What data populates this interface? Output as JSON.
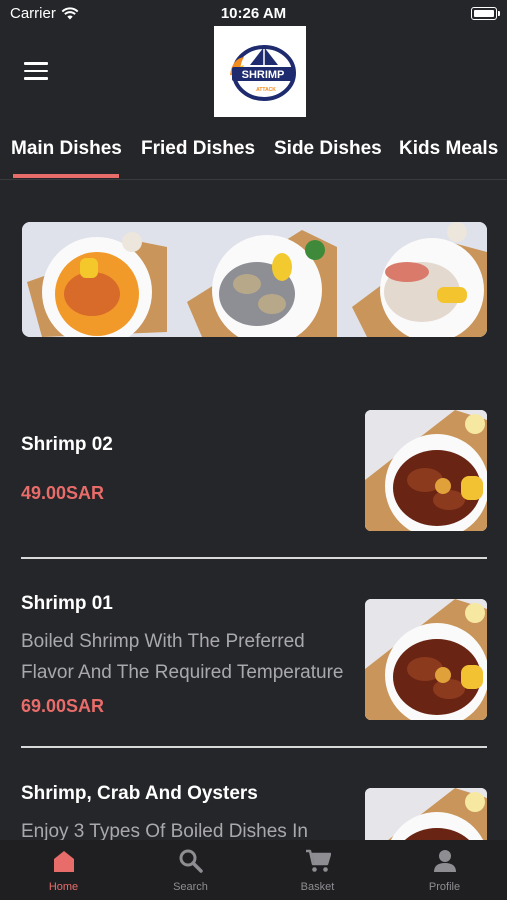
{
  "status_bar": {
    "carrier": "Carrier",
    "time": "10:26 AM"
  },
  "header": {
    "logo_text": "SHRIMP",
    "logo_subtext": "ATTACK"
  },
  "tabs": [
    {
      "label": "Main Dishes",
      "active": true
    },
    {
      "label": "Fried Dishes",
      "active": false
    },
    {
      "label": "Side Dishes",
      "active": false
    },
    {
      "label": "Kids Meals",
      "active": false
    }
  ],
  "items": [
    {
      "name": "Shrimp 02",
      "desc_line1": "",
      "desc_line2": "",
      "price": "49.00SAR"
    },
    {
      "name": "Shrimp 01",
      "desc_line1": "Boiled Shrimp With The Preferred",
      "desc_line2": "Flavor And The Required Temperature",
      "price": "69.00SAR"
    },
    {
      "name": "Shrimp, Crab And Oysters",
      "desc_line1": "Enjoy 3 Types Of Boiled Dishes In",
      "desc_line2": "",
      "price": ""
    }
  ],
  "tabbar": [
    {
      "label": "Home",
      "icon": "home-icon",
      "active": true
    },
    {
      "label": "Search",
      "icon": "search-icon",
      "active": false
    },
    {
      "label": "Basket",
      "icon": "cart-icon",
      "active": false
    },
    {
      "label": "Profile",
      "icon": "profile-icon",
      "active": false
    }
  ],
  "colors": {
    "accent": "#e86c6a",
    "background": "#252629",
    "tabbar": "#1f1f22"
  }
}
